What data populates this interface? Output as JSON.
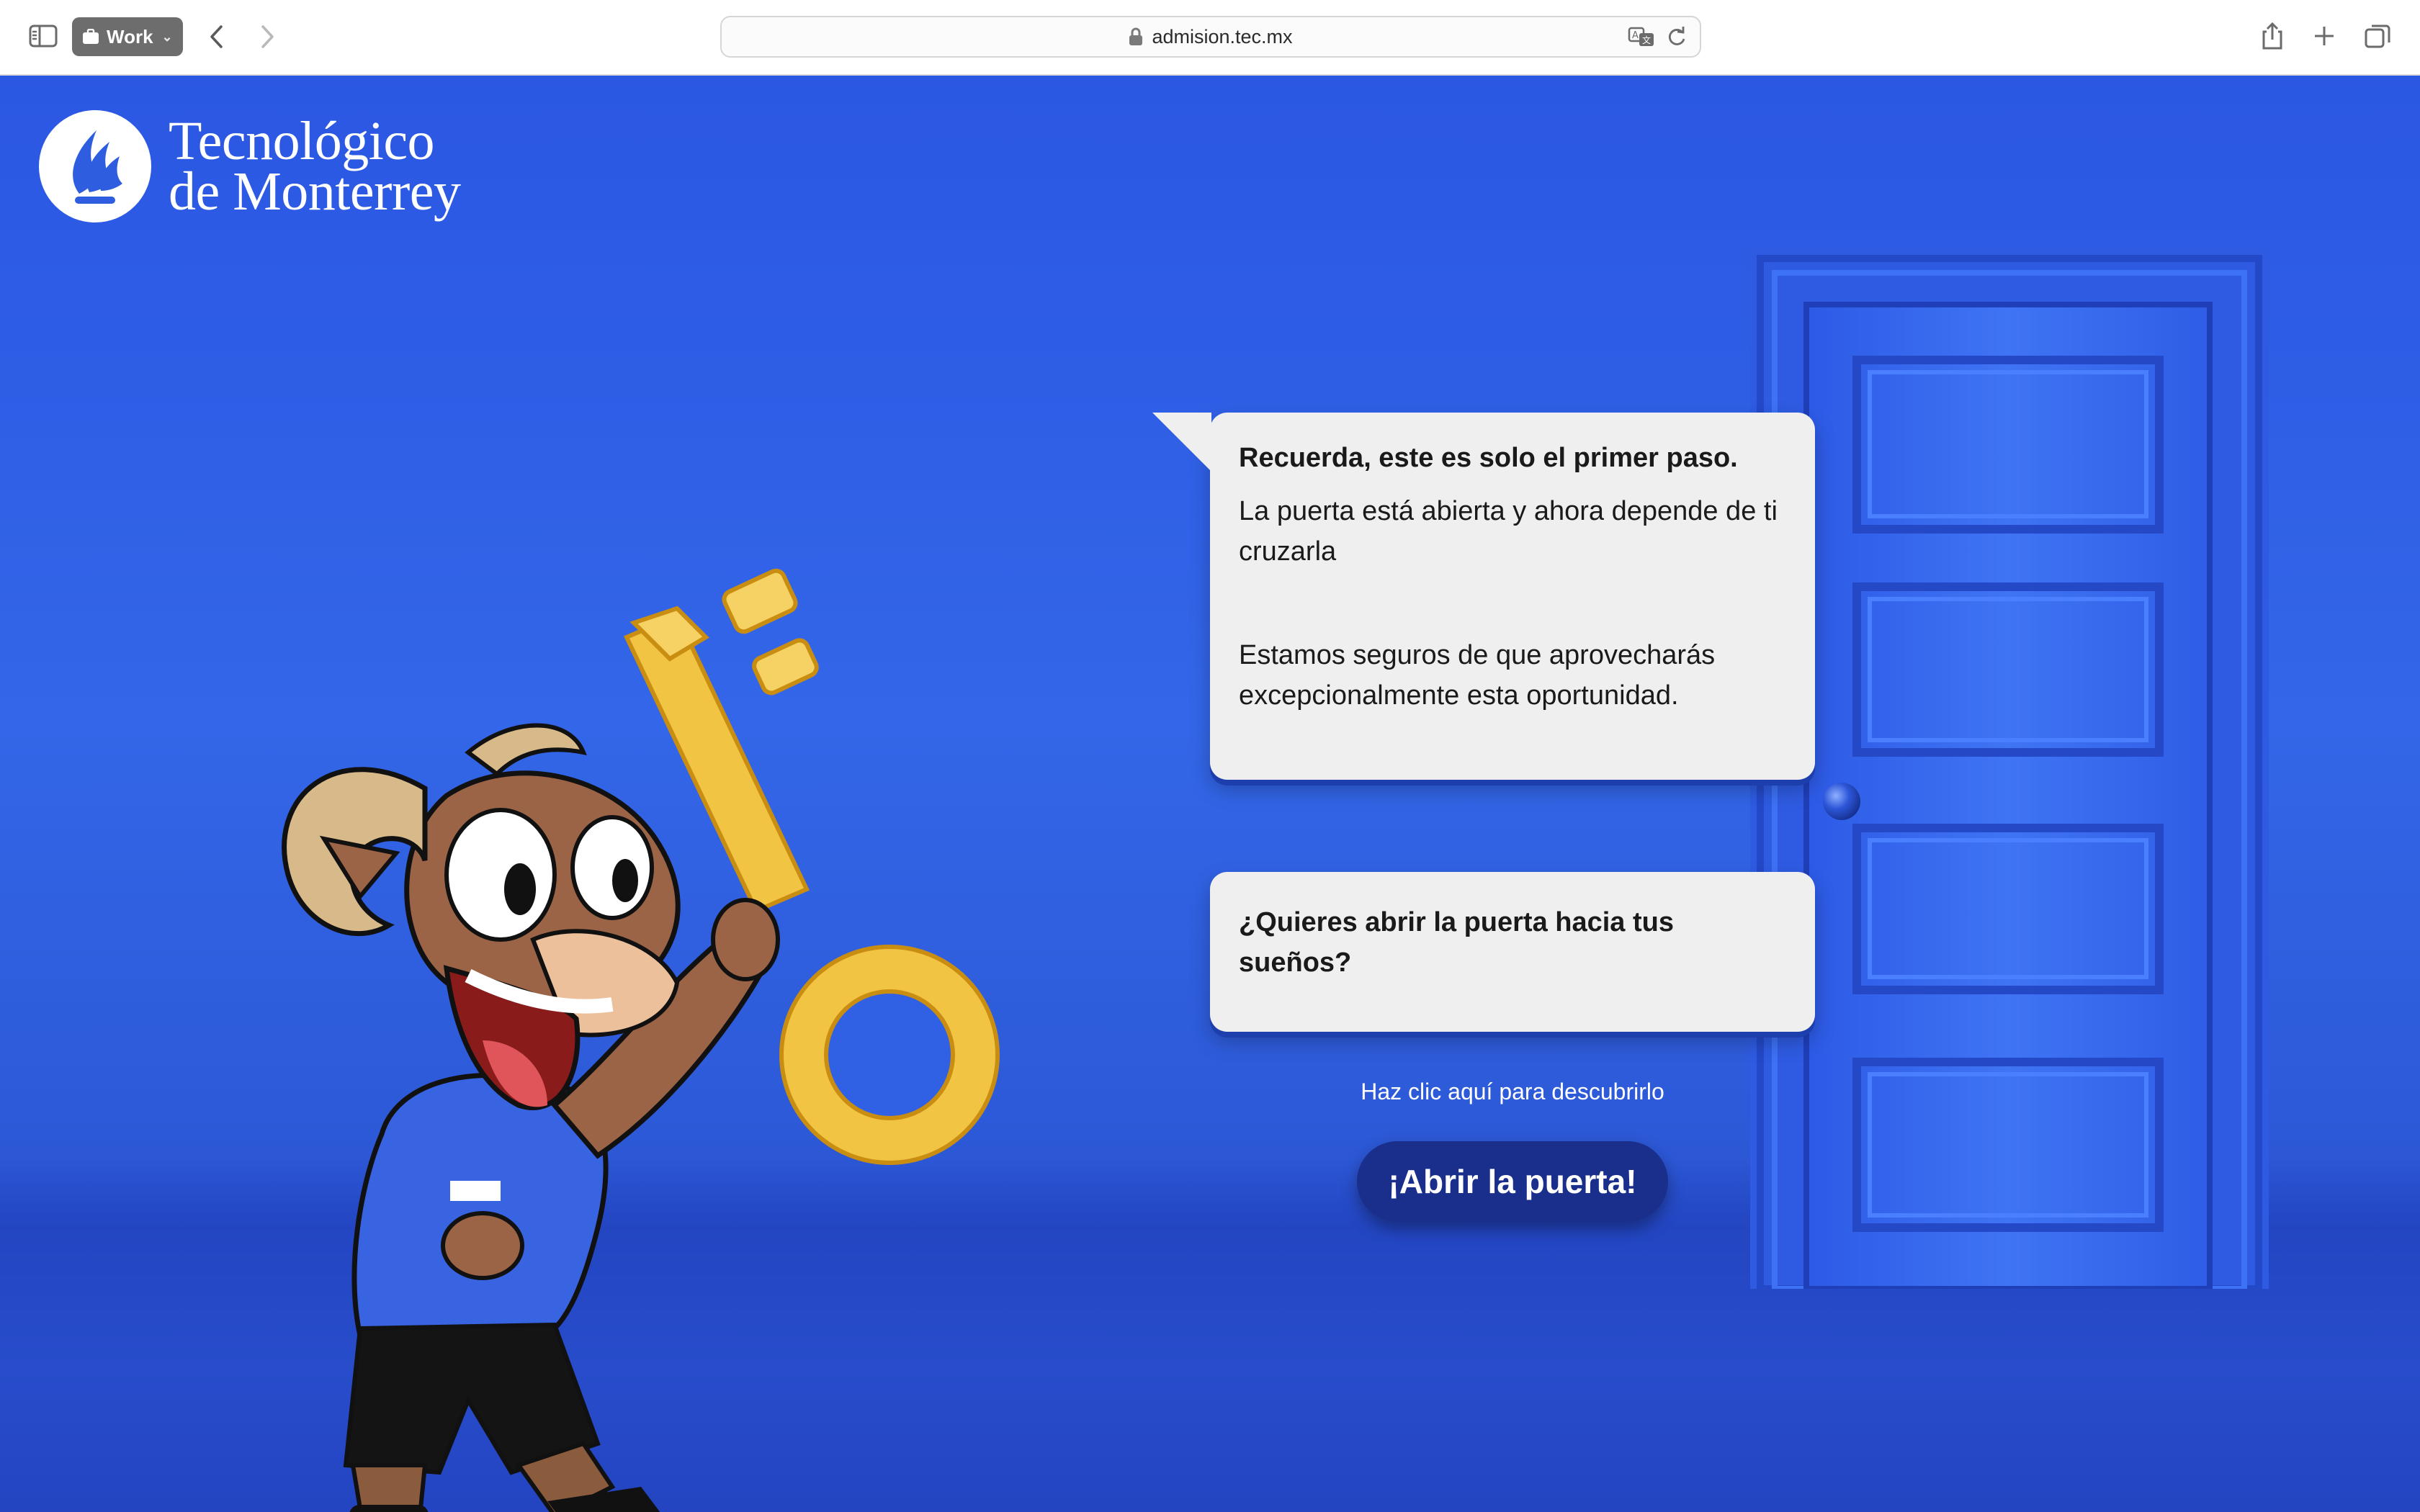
{
  "browser": {
    "profile_label": "Work",
    "url": "admision.tec.mx"
  },
  "brand": {
    "name_line1": "Tecnológico",
    "name_line2": "de Monterrey"
  },
  "bubble_main": {
    "title": "Recuerda, este es solo el primer paso.",
    "paragraph1": "La puerta está abierta y ahora depende de ti cruzarla",
    "paragraph2": "Estamos seguros de que aprovecharás excepcionalmente esta oportunidad."
  },
  "bubble_question": {
    "text": "¿Quieres abrir la puerta hacia tus sueños?"
  },
  "hint": "Haz clic aquí para descubrirlo",
  "cta_label": "¡Abrir la puerta!",
  "colors": {
    "background": "#2f5de0",
    "cta": "#1a2f8c",
    "bubble": "#efefef",
    "door": "#3a6ef0",
    "key": "#f3c64a"
  },
  "icons": [
    "sidebar-icon",
    "briefcase-icon",
    "chevron-down-icon",
    "back-chevron-icon",
    "forward-chevron-icon",
    "lock-icon",
    "translate-icon",
    "reload-icon",
    "share-icon",
    "plus-icon",
    "tabs-icon"
  ]
}
